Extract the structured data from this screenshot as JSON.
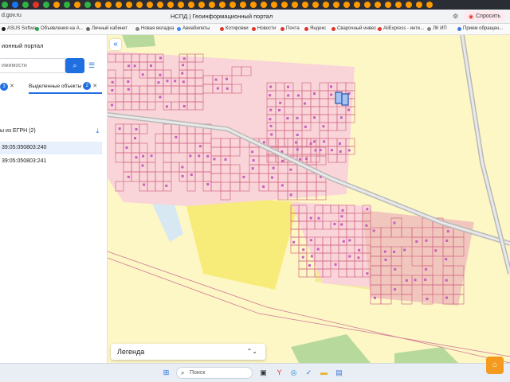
{
  "browser": {
    "url": "d.gov.ru",
    "page_title": "НСПД | Геоинформационный портал",
    "ask_button": "Спросить",
    "tab_icon_colors": [
      "#2fb344",
      "#1877f2",
      "#2fb344",
      "#e0352b",
      "#2fb344",
      "#ff9900",
      "#2fb344",
      "#ff9900",
      "#2fb344",
      "#ff9900",
      "#ff9900",
      "#ff9900",
      "#ff9900",
      "#ff9900",
      "#ff9900",
      "#ff9900",
      "#ff9900",
      "#ff9900",
      "#ff9900",
      "#ff9900",
      "#ff9900",
      "#ff9900",
      "#ff9900",
      "#ff9900",
      "#ff9900",
      "#ff9900",
      "#ff9900",
      "#ff9900",
      "#ff9900",
      "#ff9900",
      "#ff9900",
      "#ff9900",
      "#ff9900",
      "#ff9900",
      "#ff9900",
      "#ff9900",
      "#ff9900",
      "#ff9900",
      "#ff9900",
      "#ff9900",
      "#ff9900",
      "#ff9900"
    ],
    "bookmarks": [
      {
        "label": "ASUS Softwa›",
        "color": "#1b1b1b"
      },
      {
        "label": "Объявления на А...",
        "color": "#2aa44a"
      },
      {
        "label": "Личный кабинет",
        "color": "#6b6b6b"
      },
      {
        "label": "Новая вкладка",
        "color": "#888888"
      },
      {
        "label": "Авиабилеты",
        "color": "#4285f4"
      },
      {
        "label": "Котировки",
        "color": "#e0352b"
      },
      {
        "label": "Новости",
        "color": "#e0352b"
      },
      {
        "label": "Почта",
        "color": "#e0352b"
      },
      {
        "label": "Яндекс",
        "color": "#e0352b"
      },
      {
        "label": "Сварочный инвес...",
        "color": "#e0352b"
      },
      {
        "label": "AliExpress - инте...",
        "color": "#e0352b"
      },
      {
        "label": "ЛК ИП",
        "color": "#888888"
      },
      {
        "label": "Прием обращен...",
        "color": "#3a7bd5"
      }
    ]
  },
  "sidebar": {
    "title": "ионный портал",
    "search_placeholder": "ижимости",
    "search_icon": "search-icon",
    "tabs": [
      {
        "label": "",
        "count": "3"
      },
      {
        "label": "Выделенные объекты",
        "count": "2"
      }
    ],
    "egrn_header": "ы из ЕГРН (2)",
    "items": [
      {
        "label": "39:05:050803:240",
        "selected": true
      },
      {
        "label": "39:05:050803:241",
        "selected": false
      }
    ]
  },
  "map": {
    "collapse_icon": "double-chevron-left-icon",
    "legend_label": "Легенда",
    "colors": {
      "base": "#fdf7c6",
      "residential": "#f8c8cf",
      "parcel_stroke": "#d56a86",
      "building": "#c65fc0",
      "agricultural": "#f7ec7a",
      "forest": "#b7d99b",
      "water": "#d7e8f3",
      "road": "#b9b9b9",
      "highlight": "#2f5fb4"
    }
  },
  "taskbar": {
    "search_label": "Поиск",
    "icons": [
      "windows-start-icon",
      "search-icon",
      "task-view-icon",
      "file-explorer-icon",
      "yandex-browser-icon",
      "edge-browser-icon",
      "check-app-icon",
      "folder-icon",
      "store-icon"
    ]
  }
}
